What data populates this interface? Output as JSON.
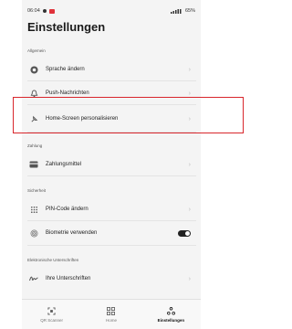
{
  "status_bar": {
    "time": "06:04",
    "battery": "65%"
  },
  "page_title": "Einstellungen",
  "sections": {
    "allgemein": "Allgemein",
    "zahlung": "Zahlung",
    "sicherheit": "Sicherheit",
    "signaturen": "Elektronische Unterschriften"
  },
  "items": {
    "sprache": "Sprache ändern",
    "push": "Push-Nachrichten",
    "homescreen": "Home-Screen personalisieren",
    "zahlungsmittel": "Zahlungsmittel",
    "pin": "PIN-Code ändern",
    "biometrie": "Biometrie verwenden",
    "unterschriften": "Ihre Unterschriften"
  },
  "toggles": {
    "biometrie_on": true
  },
  "bottom_nav": {
    "qr": "QR Scanner",
    "home": "Home",
    "settings": "Einstellungen"
  },
  "colors": {
    "highlight": "#d8262c",
    "badge": "#e0323a"
  }
}
